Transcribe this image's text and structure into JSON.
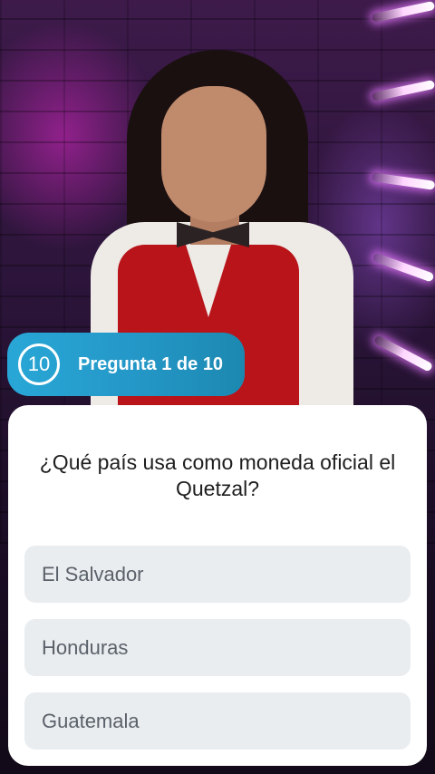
{
  "quiz": {
    "counter": "10",
    "progress_label": "Pregunta 1 de 10",
    "question": "¿Qué país usa como moneda oficial el Quetzal?",
    "options": [
      {
        "label": "El Salvador"
      },
      {
        "label": "Honduras"
      },
      {
        "label": "Guatemala"
      }
    ]
  },
  "colors": {
    "badge": "#2497c7",
    "card": "#ffffff",
    "option_bg": "#e9edf0",
    "option_text": "#5a6169",
    "question_text": "#1e1e1e"
  }
}
